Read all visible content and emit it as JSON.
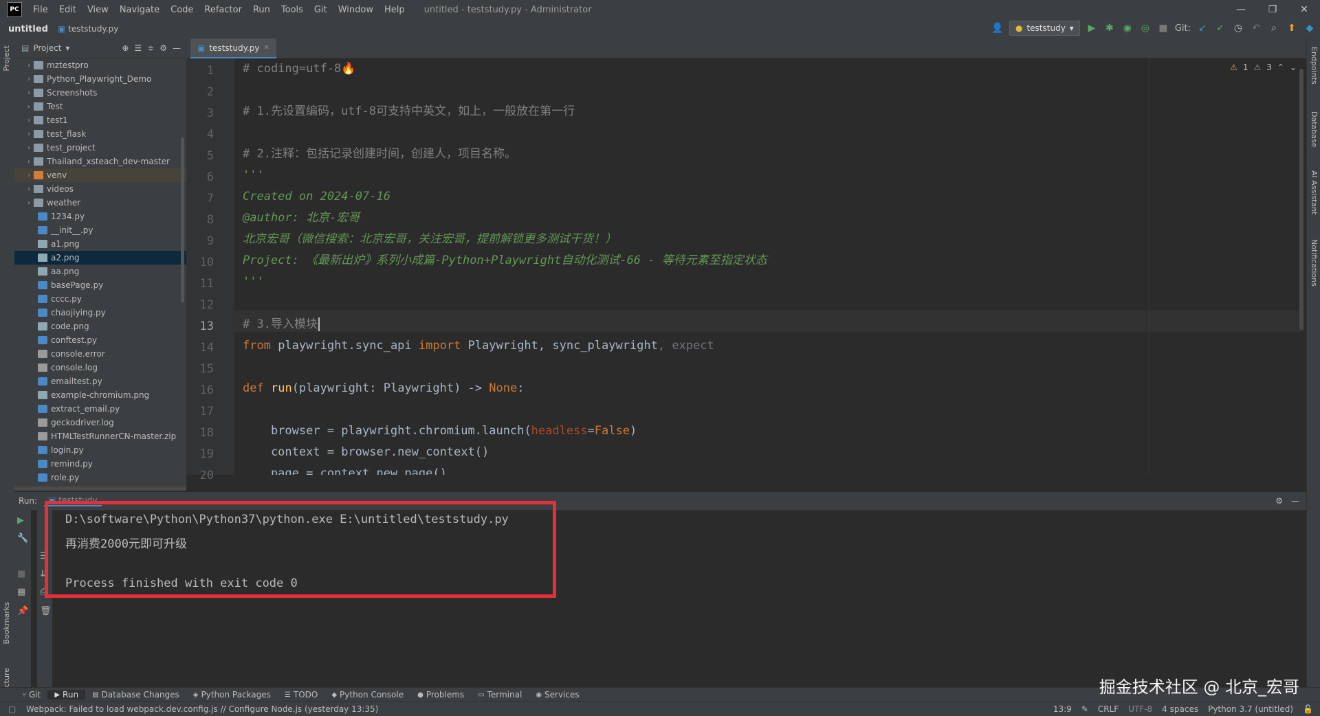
{
  "titlebar": {
    "logo": "PC",
    "menu": [
      "File",
      "Edit",
      "View",
      "Navigate",
      "Code",
      "Refactor",
      "Run",
      "Tools",
      "Git",
      "Window",
      "Help"
    ],
    "title": "untitled - teststudy.py - Administrator"
  },
  "navbar": {
    "project": "untitled",
    "file": "teststudy.py",
    "run_config": "teststudy",
    "git_label": "Git:"
  },
  "left_strip": {
    "project": "Project",
    "bookmarks": "Bookmarks",
    "structure": "Structure"
  },
  "right_strip": {
    "endpoints": "Endpoints",
    "database": "Database",
    "ai": "AI Assistant",
    "notifications": "Notifications"
  },
  "project_panel": {
    "title": "Project",
    "items": [
      {
        "name": "mztestpro",
        "type": "folder"
      },
      {
        "name": "Python_Playwright_Demo",
        "type": "folder"
      },
      {
        "name": "Screenshots",
        "type": "folder"
      },
      {
        "name": "Test",
        "type": "folder"
      },
      {
        "name": "test1",
        "type": "folder"
      },
      {
        "name": "test_flask",
        "type": "folder"
      },
      {
        "name": "test_project",
        "type": "folder"
      },
      {
        "name": "Thailand_xsteach_dev-master",
        "type": "folder"
      },
      {
        "name": "venv",
        "type": "folder-orange"
      },
      {
        "name": "videos",
        "type": "folder"
      },
      {
        "name": "weather",
        "type": "folder"
      },
      {
        "name": "1234.py",
        "type": "py"
      },
      {
        "name": "__init__.py",
        "type": "py"
      },
      {
        "name": "a1.png",
        "type": "img"
      },
      {
        "name": "a2.png",
        "type": "img"
      },
      {
        "name": "aa.png",
        "type": "img"
      },
      {
        "name": "basePage.py",
        "type": "py"
      },
      {
        "name": "cccc.py",
        "type": "py"
      },
      {
        "name": "chaojiying.py",
        "type": "py"
      },
      {
        "name": "code.png",
        "type": "img"
      },
      {
        "name": "conftest.py",
        "type": "py"
      },
      {
        "name": "console.error",
        "type": "txt"
      },
      {
        "name": "console.log",
        "type": "txt"
      },
      {
        "name": "emailtest.py",
        "type": "py"
      },
      {
        "name": "example-chromium.png",
        "type": "img"
      },
      {
        "name": "extract_email.py",
        "type": "py"
      },
      {
        "name": "geckodriver.log",
        "type": "txt"
      },
      {
        "name": "HTMLTestRunnerCN-master.zip",
        "type": "txt"
      },
      {
        "name": "login.py",
        "type": "py"
      },
      {
        "name": "remind.py",
        "type": "py"
      },
      {
        "name": "role.py",
        "type": "py"
      }
    ]
  },
  "editor": {
    "tab": "teststudy.py",
    "inspect_warn": "1",
    "inspect_weak": "3",
    "line_numbers": [
      "1",
      "2",
      "3",
      "4",
      "5",
      "6",
      "7",
      "8",
      "9",
      "10",
      "11",
      "12",
      "13",
      "14",
      "15",
      "16",
      "17",
      "18",
      "19",
      "20"
    ],
    "lines": {
      "l1": "# coding=utf-8",
      "l3": "# 1.先设置编码，utf-8可支持中英文，如上，一般放在第一行",
      "l5": "# 2.注释：包括记录创建时间，创建人，项目名称。",
      "l6": "'''",
      "l7": "Created on 2024-07-16",
      "l8": "@author: 北京-宏哥",
      "l9": "北京宏哥（微信搜索：北京宏哥，关注宏哥，提前解锁更多测试干货！）",
      "l10": "Project: 《最新出炉》系列小成篇-Python+Playwright自动化测试-66 - 等待元素至指定状态",
      "l11": "'''",
      "l13": "# 3.导入模块",
      "l14_from": "from",
      "l14_mod": " playwright.sync_api ",
      "l14_import": "import",
      "l14_names": " Playwright, sync_playwright",
      "l14_expect": ", expect",
      "l16_def": "def",
      "l16_fn": "run",
      "l16_rest": "(playwright: Playwright) -> ",
      "l16_none": "None",
      "l16_colon": ":",
      "l18_a": "    browser = playwright.chromium.launch(",
      "l18_param": "headless",
      "l18_eq": "=",
      "l18_false": "False",
      "l18_close": ")",
      "l19": "    context = browser.new_context()",
      "l20": "    page = context.new_page()"
    }
  },
  "run_panel": {
    "label": "Run:",
    "output": [
      "D:\\software\\Python\\Python37\\python.exe E:\\untitled\\teststudy.py",
      "再消费2000元即可升级",
      "",
      "Process finished with exit code 0"
    ]
  },
  "bottom_tabs": [
    "Git",
    "Run",
    "Database Changes",
    "Python Packages",
    "TODO",
    "Python Console",
    "Problems",
    "Terminal",
    "Services"
  ],
  "status": {
    "message": "Webpack: Failed to load webpack.dev.config.js // Configure Node.js (yesterday 13:35)",
    "position": "13:9",
    "line_sep": "CRLF",
    "encoding": "UTF-8",
    "indent": "4 spaces",
    "interpreter": "Python 3.7 (untitled)"
  },
  "watermark": "掘金技术社区 @ 北京_宏哥"
}
